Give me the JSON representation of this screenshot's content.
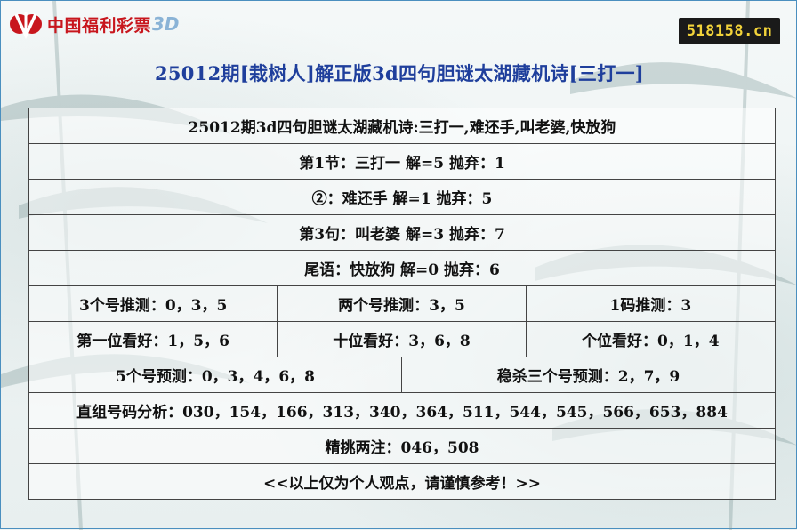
{
  "logo": {
    "brand": "中国福利彩票",
    "suffix": "3D"
  },
  "site_badge": "518158.cn",
  "page_title": "25012期[栽树人]解正版3d四句胆谜太湖藏机诗[三打一]",
  "rows": {
    "poem_header": "25012期3d四句胆谜太湖藏机诗:三打一,难还手,叫老婆,快放狗",
    "line1": "第1节：三打一 解=5 抛弃：1",
    "line2": "②：难还手 解=1 抛弃：5",
    "line3": "第3句：叫老婆 解=3 抛弃：7",
    "line4": "尾语：快放狗 解=0 抛弃：6",
    "three_pick": "3个号推测：0，3，5",
    "two_pick": "两个号推测：3，5",
    "one_code": "1码推测：3",
    "hundreds": "第一位看好：1，5，6",
    "tens": "十位看好：3，6，8",
    "units": "个位看好：0，1，4",
    "five_pick": "5个号预测：0，3，4，6，8",
    "kill_three": "稳杀三个号预测：2，7，9",
    "group_analysis": "直组号码分析：030，154，166，313，340，364，511，544，545，566，653，884",
    "best_two": "精挑两注：046，508",
    "disclaimer": "<<以上仅为个人观点，请谨慎参考！>>"
  },
  "colors": {
    "title": "#1f3f9c",
    "brand_red": "#c8161d",
    "badge_bg": "#1a1a1a",
    "badge_text": "#f2d33a"
  }
}
